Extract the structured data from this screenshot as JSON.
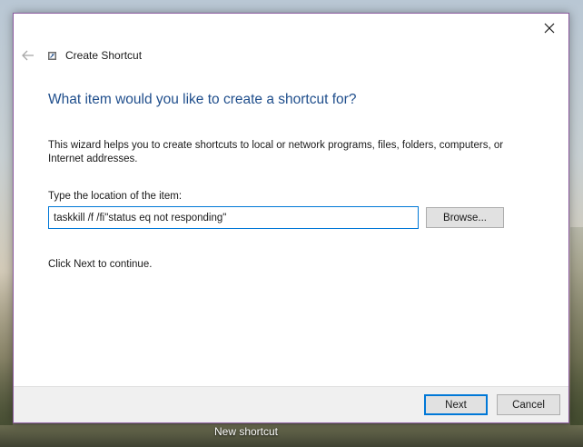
{
  "desktop": {
    "shortcut_label": "New shortcut"
  },
  "dialog": {
    "title": "Create Shortcut",
    "heading": "What item would you like to create a shortcut for?",
    "description": "This wizard helps you to create shortcuts to local or network programs, files, folders, computers, or Internet addresses.",
    "location_label": "Type the location of the item:",
    "location_value": "taskkill /f /fi\"status eq not responding\"",
    "browse_label": "Browse...",
    "continue_text": "Click Next to continue.",
    "next_label": "Next",
    "cancel_label": "Cancel"
  },
  "icons": {
    "close": "close-icon",
    "back": "back-arrow-icon",
    "app": "shortcut-wizard-icon"
  },
  "colors": {
    "heading": "#1f4e8c",
    "accent": "#0078d7",
    "window_border": "#8a5a9e"
  }
}
